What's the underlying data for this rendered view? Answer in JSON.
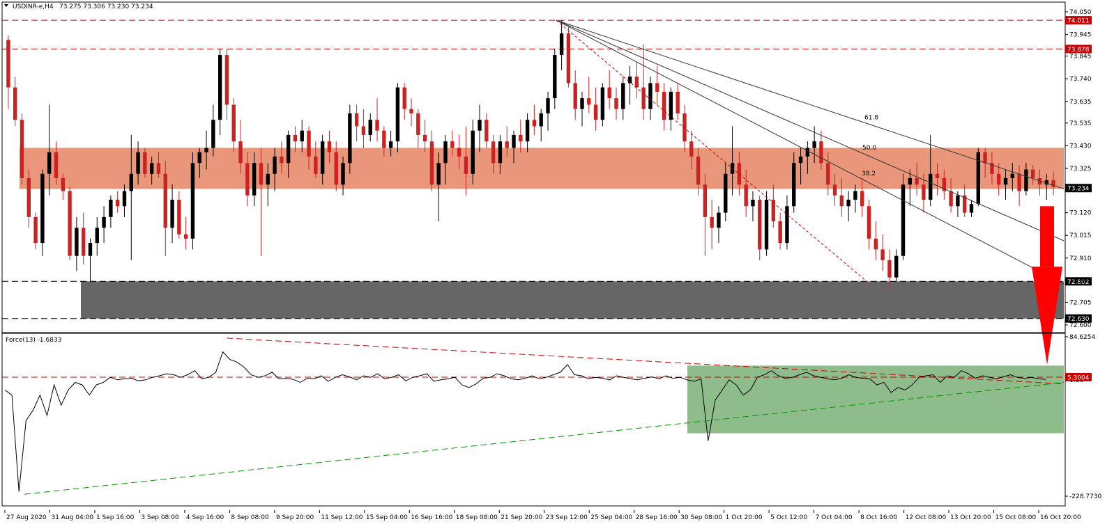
{
  "header": {
    "symbol_title": "USDINR-e,H4",
    "ohlc": "73.275 73.306 73.230 73.234"
  },
  "indicator": {
    "title": "Force(13) -1.6833"
  },
  "colors": {
    "bull_candle": "#000000",
    "bear_candle": "#cc2222",
    "resistance_zone": "#e9967a",
    "support_zone": "#666666",
    "dashed_red": "#cc0000",
    "force_zone": "#8fbc8b",
    "force_trend_green": "#009900",
    "arrow": "#ff0000"
  },
  "chart_data": {
    "type": "candlestick",
    "symbol": "USDINR-e",
    "timeframe": "H4",
    "price_axis": {
      "ylim": [
        72.6,
        74.05
      ],
      "ticks": [
        "74.050",
        "73.945",
        "73.845",
        "73.740",
        "73.635",
        "73.535",
        "73.430",
        "73.325",
        "73.225",
        "73.120",
        "73.015",
        "72.910",
        "72.805",
        "72.705",
        "72.600"
      ]
    },
    "time_labels": [
      "27 Aug 2020",
      "31 Aug 04:00",
      "1 Sep 16:00",
      "3 Sep 08:00",
      "4 Sep 16:00",
      "8 Sep 08:00",
      "9 Sep 20:00",
      "11 Sep 12:00",
      "15 Sep 04:00",
      "16 Sep 16:00",
      "18 Sep 08:00",
      "21 Sep 20:00",
      "23 Sep 12:00",
      "25 Sep 04:00",
      "28 Sep 16:00",
      "30 Sep 08:00",
      "1 Oct 20:00",
      "5 Oct 12:00",
      "7 Oct 04:00",
      "8 Oct 16:00",
      "12 Oct 08:00",
      "13 Oct 20:00",
      "15 Oct 08:00",
      "16 Oct 20:00"
    ],
    "horizontal_levels": [
      {
        "label": "74.011",
        "value": 74.011,
        "style": "red-dashed"
      },
      {
        "label": "73.878",
        "value": 73.878,
        "style": "red-dashed"
      },
      {
        "label": "72.802",
        "value": 72.802,
        "style": "black-dashed"
      },
      {
        "label": "72.630",
        "value": 72.63,
        "style": "black-dashed"
      }
    ],
    "current_price": {
      "label": "73.234",
      "value": 73.234
    },
    "resistance_zone": {
      "from": 73.23,
      "to": 73.42
    },
    "support_zone": {
      "from": 72.63,
      "to": 72.802
    },
    "fibonacci_fan": [
      {
        "label": "61.8",
        "end_price": 73.23
      },
      {
        "label": "50.0",
        "end_price": 72.99
      },
      {
        "label": "38.2",
        "end_price": 72.79
      }
    ],
    "candles": [
      [
        73.92,
        73.94,
        73.6,
        73.7
      ],
      [
        73.7,
        73.75,
        73.52,
        73.55
      ],
      [
        73.55,
        73.58,
        73.25,
        73.28
      ],
      [
        73.28,
        73.32,
        73.05,
        73.1
      ],
      [
        73.1,
        73.12,
        72.95,
        72.98
      ],
      [
        72.98,
        73.32,
        72.92,
        73.3
      ],
      [
        73.3,
        73.62,
        73.2,
        73.4
      ],
      [
        73.4,
        73.45,
        73.25,
        73.28
      ],
      [
        73.28,
        73.3,
        73.18,
        73.22
      ],
      [
        73.22,
        73.24,
        72.9,
        72.92
      ],
      [
        72.92,
        73.1,
        72.85,
        73.05
      ],
      [
        73.05,
        73.12,
        72.88,
        72.92
      ],
      [
        72.92,
        73.0,
        72.8,
        72.98
      ],
      [
        72.98,
        73.1,
        72.92,
        73.05
      ],
      [
        73.05,
        73.15,
        72.98,
        73.1
      ],
      [
        73.1,
        73.2,
        73.05,
        73.18
      ],
      [
        73.18,
        73.22,
        73.12,
        73.15
      ],
      [
        73.15,
        73.25,
        73.1,
        73.22
      ],
      [
        73.22,
        73.48,
        72.9,
        73.3
      ],
      [
        73.3,
        73.45,
        73.25,
        73.4
      ],
      [
        73.4,
        73.42,
        73.28,
        73.3
      ],
      [
        73.3,
        73.38,
        73.25,
        73.35
      ],
      [
        73.35,
        73.4,
        73.28,
        73.3
      ],
      [
        73.3,
        73.36,
        72.92,
        73.05
      ],
      [
        73.05,
        73.25,
        72.98,
        73.18
      ],
      [
        73.18,
        73.22,
        73.0,
        73.02
      ],
      [
        73.02,
        73.1,
        72.95,
        73.0
      ],
      [
        73.0,
        73.4,
        72.95,
        73.35
      ],
      [
        73.35,
        73.42,
        73.28,
        73.4
      ],
      [
        73.4,
        73.5,
        73.32,
        73.42
      ],
      [
        73.42,
        73.62,
        73.38,
        73.55
      ],
      [
        73.55,
        73.88,
        73.48,
        73.85
      ],
      [
        73.85,
        73.88,
        73.55,
        73.62
      ],
      [
        73.62,
        73.65,
        73.4,
        73.45
      ],
      [
        73.45,
        73.55,
        73.3,
        73.35
      ],
      [
        73.35,
        73.4,
        73.15,
        73.2
      ],
      [
        73.2,
        73.4,
        73.15,
        73.35
      ],
      [
        73.35,
        73.42,
        72.92,
        73.25
      ],
      [
        73.25,
        73.35,
        73.15,
        73.3
      ],
      [
        73.3,
        73.42,
        73.22,
        73.38
      ],
      [
        73.38,
        73.45,
        73.3,
        73.35
      ],
      [
        73.35,
        73.5,
        73.28,
        73.48
      ],
      [
        73.48,
        73.52,
        73.4,
        73.45
      ],
      [
        73.45,
        73.55,
        73.4,
        73.5
      ],
      [
        73.5,
        73.52,
        73.32,
        73.38
      ],
      [
        73.38,
        73.45,
        73.28,
        73.3
      ],
      [
        73.3,
        73.48,
        73.25,
        73.45
      ],
      [
        73.45,
        73.5,
        73.35,
        73.4
      ],
      [
        73.4,
        73.45,
        73.22,
        73.25
      ],
      [
        73.25,
        73.38,
        73.2,
        73.35
      ],
      [
        73.35,
        73.62,
        73.3,
        73.58
      ],
      [
        73.58,
        73.62,
        73.45,
        73.52
      ],
      [
        73.52,
        73.6,
        73.42,
        73.48
      ],
      [
        73.48,
        73.58,
        73.45,
        73.55
      ],
      [
        73.55,
        73.65,
        73.45,
        73.5
      ],
      [
        73.5,
        73.52,
        73.38,
        73.42
      ],
      [
        73.42,
        73.5,
        73.38,
        73.45
      ],
      [
        73.45,
        73.72,
        73.4,
        73.7
      ],
      [
        73.7,
        73.72,
        73.55,
        73.6
      ],
      [
        73.6,
        73.65,
        73.52,
        73.58
      ],
      [
        73.58,
        73.6,
        73.42,
        73.48
      ],
      [
        73.48,
        73.55,
        73.4,
        73.45
      ],
      [
        73.45,
        73.5,
        73.22,
        73.25
      ],
      [
        73.25,
        73.4,
        73.08,
        73.35
      ],
      [
        73.35,
        73.48,
        73.25,
        73.45
      ],
      [
        73.45,
        73.5,
        73.38,
        73.42
      ],
      [
        73.42,
        73.48,
        73.32,
        73.38
      ],
      [
        73.38,
        73.52,
        73.2,
        73.3
      ],
      [
        73.3,
        73.55,
        73.25,
        73.5
      ],
      [
        73.5,
        73.62,
        73.4,
        73.55
      ],
      [
        73.55,
        73.58,
        73.42,
        73.45
      ],
      [
        73.45,
        73.48,
        73.3,
        73.35
      ],
      [
        73.35,
        73.48,
        73.3,
        73.45
      ],
      [
        73.45,
        73.52,
        73.38,
        73.42
      ],
      [
        73.42,
        73.5,
        73.35,
        73.48
      ],
      [
        73.48,
        73.55,
        73.4,
        73.45
      ],
      [
        73.45,
        73.58,
        73.4,
        73.55
      ],
      [
        73.55,
        73.62,
        73.48,
        73.52
      ],
      [
        73.52,
        73.6,
        73.45,
        73.58
      ],
      [
        73.58,
        73.68,
        73.5,
        73.65
      ],
      [
        73.65,
        73.88,
        73.6,
        73.85
      ],
      [
        73.85,
        74.01,
        73.78,
        73.95
      ],
      [
        73.95,
        73.98,
        73.7,
        73.72
      ],
      [
        73.72,
        73.78,
        73.55,
        73.6
      ],
      [
        73.6,
        73.68,
        73.52,
        73.65
      ],
      [
        73.65,
        73.75,
        73.58,
        73.62
      ],
      [
        73.62,
        73.7,
        73.5,
        73.55
      ],
      [
        73.55,
        73.72,
        73.52,
        73.7
      ],
      [
        73.7,
        73.78,
        73.6,
        73.65
      ],
      [
        73.65,
        73.7,
        73.55,
        73.6
      ],
      [
        73.6,
        73.75,
        73.55,
        73.72
      ],
      [
        73.72,
        73.8,
        73.62,
        73.75
      ],
      [
        73.75,
        73.82,
        73.65,
        73.7
      ],
      [
        73.7,
        73.9,
        73.55,
        73.6
      ],
      [
        73.6,
        73.75,
        73.55,
        73.72
      ],
      [
        73.72,
        73.8,
        73.62,
        73.68
      ],
      [
        73.68,
        73.72,
        73.5,
        73.55
      ],
      [
        73.55,
        73.7,
        73.5,
        73.68
      ],
      [
        73.68,
        73.72,
        73.55,
        73.58
      ],
      [
        73.58,
        73.62,
        73.4,
        73.45
      ],
      [
        73.45,
        73.5,
        73.32,
        73.38
      ],
      [
        73.38,
        73.42,
        73.2,
        73.25
      ],
      [
        73.25,
        73.3,
        72.92,
        73.1
      ],
      [
        73.1,
        73.18,
        72.95,
        73.05
      ],
      [
        73.05,
        73.15,
        72.98,
        73.12
      ],
      [
        73.12,
        73.35,
        73.08,
        73.3
      ],
      [
        73.3,
        73.52,
        73.2,
        73.35
      ],
      [
        73.35,
        73.4,
        73.2,
        73.25
      ],
      [
        73.25,
        73.32,
        73.1,
        73.15
      ],
      [
        73.15,
        73.22,
        73.08,
        73.18
      ],
      [
        73.18,
        73.2,
        72.9,
        72.95
      ],
      [
        72.95,
        73.22,
        72.92,
        73.18
      ],
      [
        73.18,
        73.25,
        73.05,
        73.08
      ],
      [
        73.08,
        73.12,
        72.95,
        72.98
      ],
      [
        72.98,
        73.2,
        72.95,
        73.15
      ],
      [
        73.15,
        73.4,
        73.12,
        73.35
      ],
      [
        73.35,
        73.42,
        73.25,
        73.38
      ],
      [
        73.38,
        73.45,
        73.3,
        73.42
      ],
      [
        73.42,
        73.52,
        73.35,
        73.45
      ],
      [
        73.45,
        73.5,
        73.32,
        73.35
      ],
      [
        73.35,
        73.4,
        73.2,
        73.25
      ],
      [
        73.25,
        73.3,
        73.15,
        73.2
      ],
      [
        73.2,
        73.28,
        73.1,
        73.15
      ],
      [
        73.15,
        73.22,
        73.08,
        73.18
      ],
      [
        73.18,
        73.25,
        73.12,
        73.22
      ],
      [
        73.22,
        73.28,
        73.1,
        73.15
      ],
      [
        73.15,
        73.18,
        72.95,
        73.0
      ],
      [
        73.0,
        73.08,
        72.9,
        72.95
      ],
      [
        72.95,
        73.02,
        72.85,
        72.9
      ],
      [
        72.9,
        72.95,
        72.76,
        72.82
      ],
      [
        72.82,
        72.95,
        72.8,
        72.92
      ],
      [
        72.92,
        73.3,
        72.9,
        73.25
      ],
      [
        73.25,
        73.32,
        73.15,
        73.28
      ],
      [
        73.28,
        73.35,
        73.2,
        73.25
      ],
      [
        73.25,
        73.3,
        73.12,
        73.18
      ],
      [
        73.18,
        73.48,
        73.15,
        73.3
      ],
      [
        73.3,
        73.35,
        73.2,
        73.28
      ],
      [
        73.28,
        73.32,
        73.18,
        73.22
      ],
      [
        73.22,
        73.28,
        73.12,
        73.15
      ],
      [
        73.15,
        73.22,
        73.1,
        73.2
      ],
      [
        73.2,
        73.25,
        73.1,
        73.12
      ],
      [
        73.12,
        73.18,
        73.1,
        73.16
      ],
      [
        73.16,
        73.42,
        73.15,
        73.4
      ],
      [
        73.4,
        73.42,
        73.28,
        73.35
      ],
      [
        73.35,
        73.4,
        73.25,
        73.3
      ],
      [
        73.3,
        73.35,
        73.2,
        73.25
      ],
      [
        73.25,
        73.32,
        73.18,
        73.28
      ],
      [
        73.28,
        73.35,
        73.22,
        73.3
      ],
      [
        73.3,
        73.34,
        73.15,
        73.22
      ],
      [
        73.22,
        73.35,
        73.2,
        73.32
      ],
      [
        73.32,
        73.34,
        73.25,
        73.28
      ],
      [
        73.28,
        73.32,
        73.2,
        73.25
      ],
      [
        73.25,
        73.3,
        73.18,
        73.27
      ],
      [
        73.27,
        73.31,
        73.2,
        73.24
      ]
    ],
    "force_index": {
      "name": "Force(13)",
      "last_value": -1.6833,
      "axis_ticks": [
        "84.6254",
        "0.00",
        "-228.7730"
      ],
      "ylim": [
        -228.773,
        84.6254
      ],
      "highlighted_level": {
        "label": "5.3004",
        "value": 5.3004
      },
      "values": [
        -20,
        -30,
        -220,
        -80,
        -60,
        -30,
        -70,
        -10,
        -50,
        -20,
        -5,
        -10,
        -30,
        -10,
        -5,
        5,
        0,
        2,
        3,
        -2,
        0,
        5,
        8,
        12,
        10,
        5,
        10,
        18,
        2,
        5,
        15,
        55,
        40,
        35,
        25,
        10,
        5,
        8,
        15,
        2,
        3,
        1,
        -5,
        3,
        2,
        8,
        -3,
        5,
        10,
        6,
        0,
        8,
        5,
        12,
        2,
        5,
        10,
        -2,
        5,
        8,
        12,
        -3,
        0,
        2,
        5,
        -10,
        -15,
        -8,
        3,
        5,
        12,
        8,
        2,
        0,
        3,
        8,
        2,
        5,
        10,
        15,
        30,
        10,
        8,
        2,
        5,
        3,
        0,
        8,
        5,
        2,
        0,
        3,
        6,
        2,
        8,
        3,
        5,
        0,
        -3,
        2,
        -120,
        -40,
        -20,
        0,
        -10,
        -30,
        -20,
        5,
        10,
        18,
        8,
        3,
        5,
        10,
        15,
        8,
        5,
        2,
        0,
        3,
        10,
        5,
        3,
        2,
        -10,
        -5,
        -25,
        -15,
        -20,
        -10,
        5,
        8,
        10,
        -5,
        8,
        5,
        18,
        12,
        3,
        8,
        5,
        2,
        6,
        10,
        5,
        3,
        5,
        2,
        1
      ]
    }
  }
}
